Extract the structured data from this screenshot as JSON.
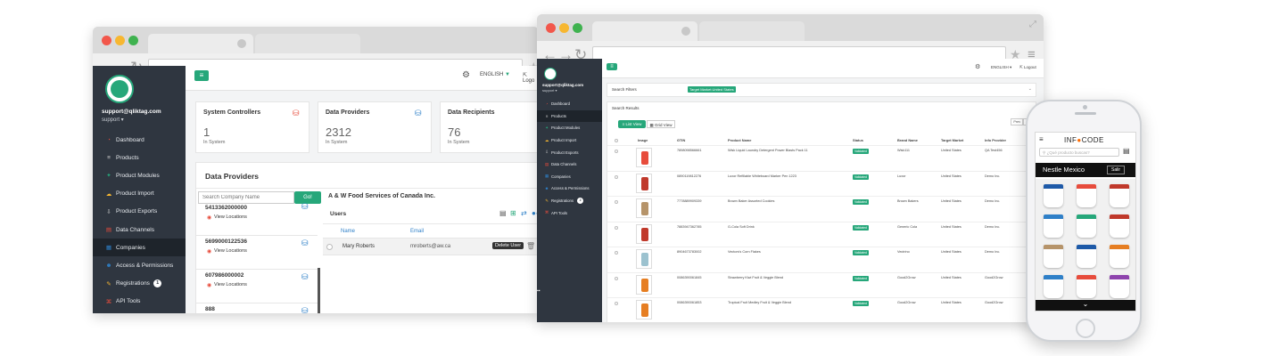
{
  "colors": {
    "accent": "#26a77a",
    "sidebar": "#2f3640",
    "brand_orange": "#ff6b00",
    "red": "#e74c3c",
    "blue": "#2f80c8"
  },
  "b1": {
    "user_email": "support@qliktag.com",
    "user_role": "support ▾",
    "lang": "ENGLISH",
    "logout": "Logo",
    "menu": [
      {
        "label": "Dashboard",
        "icon": "dashboard-icon"
      },
      {
        "label": "Products",
        "icon": "list-icon"
      },
      {
        "label": "Product Modules",
        "icon": "puzzle-icon"
      },
      {
        "label": "Product Import",
        "icon": "cloud-upload-icon"
      },
      {
        "label": "Product Exports",
        "icon": "export-icon"
      },
      {
        "label": "Data Channels",
        "icon": "file-icon"
      },
      {
        "label": "Companies",
        "icon": "building-icon"
      },
      {
        "label": "Access & Permissions",
        "icon": "users-icon"
      },
      {
        "label": "Registrations",
        "icon": "edit-icon",
        "badge": "1"
      },
      {
        "label": "API Tools",
        "icon": "api-icon"
      }
    ],
    "stats": [
      {
        "title": "System Controllers",
        "value": "1",
        "sub": "In System"
      },
      {
        "title": "Data Providers",
        "value": "2312",
        "sub": "In System"
      },
      {
        "title": "Data Recipients",
        "value": "76",
        "sub": "In System"
      }
    ],
    "providers_title": "Data Providers",
    "search_placeholder": "Search Company Name",
    "search_btn": "Go!",
    "providers": [
      {
        "code": "5413362000000",
        "link": "View Locations"
      },
      {
        "code": "5699000122536",
        "link": "View Locations"
      },
      {
        "code": "607986000002",
        "link": "View Locations"
      },
      {
        "code": "888",
        "link": ""
      }
    ],
    "company_name": "A & W Food Services of Canada Inc.",
    "users_title": "Users",
    "users_headers": [
      "Name",
      "Email"
    ],
    "user_row": {
      "name": "Mary Roberts",
      "email": "mroberts@aw.ca"
    },
    "tooltip": "Delete User"
  },
  "b2": {
    "user_email": "support@qliktag.com",
    "user_role": "support ▾",
    "lang": "ENGLISH ▾",
    "logout": "Logout",
    "menu": [
      {
        "label": "Dashboard",
        "icon": "dashboard-icon"
      },
      {
        "label": "Products",
        "icon": "list-icon"
      },
      {
        "label": "Product Modules",
        "icon": "puzzle-icon"
      },
      {
        "label": "Product Import",
        "icon": "cloud-upload-icon"
      },
      {
        "label": "Product Exports",
        "icon": "export-icon"
      },
      {
        "label": "Data Channels",
        "icon": "file-icon"
      },
      {
        "label": "Companies",
        "icon": "building-icon"
      },
      {
        "label": "Access & Permissions",
        "icon": "users-icon"
      },
      {
        "label": "Registrations",
        "icon": "edit-icon",
        "badge": "2"
      },
      {
        "label": "API Tools",
        "icon": "api-icon"
      }
    ],
    "filters_label": "Search Filters",
    "filter_chip": "Target Market:United States",
    "results_label": "Search Results",
    "list_view": "List View",
    "grid_view": "Grid View",
    "pager": [
      "Prev",
      "Next"
    ],
    "headers": [
      "Image",
      "GTIN",
      "Product Name",
      "Status",
      "Brand Name",
      "Target Market",
      "Info Provider"
    ],
    "rows": [
      {
        "gtin": "7898098566661",
        "name": "Wisk Liquid Laundry Detergent Power Blasts Pack 11",
        "status": "Validated",
        "brand": "Wisk111",
        "market": "United States",
        "provider": "QA Test456"
      },
      {
        "gtin": "0890119812276",
        "name": "Luxor Refillable Whiteboard Marker Pen 1223",
        "status": "Validated",
        "brand": "Luxor",
        "market": "United States",
        "provider": "Demo Inc."
      },
      {
        "gtin": "7778889909339",
        "name": "Brown Baker Assorted Cookies",
        "status": "Validated",
        "brand": "Brown Bakers",
        "market": "United States",
        "provider": "Demo Inc."
      },
      {
        "gtin": "7883947362785",
        "name": "G-Cola Soft Drink",
        "status": "Validated",
        "brand": "Generic Cola",
        "market": "United States",
        "provider": "Demo Inc."
      },
      {
        "gtin": "8904673783002",
        "name": "Vectors's Corn Flakes",
        "status": "Validated",
        "brand": "Vectrino",
        "market": "United States",
        "provider": "Demo Inc."
      },
      {
        "gtin": "0086390061845",
        "name": "Strawberry Kiwi Fruit & Veggie Blend",
        "status": "Validated",
        "brand": "Good2Grow",
        "market": "United States",
        "provider": "Good2Grow"
      },
      {
        "gtin": "0086390061853",
        "name": "Tropical Fruit Medley Fruit & Veggie Blend",
        "status": "Validated",
        "brand": "Good2Grow",
        "market": "United States",
        "provider": "Good2Grow"
      }
    ]
  },
  "phone": {
    "logo_left": "INF",
    "logo_right": "CODE",
    "search_placeholder": "¿Qué producto buscas?",
    "store": "Nestle Mexico",
    "exit_btn": "Salir"
  }
}
